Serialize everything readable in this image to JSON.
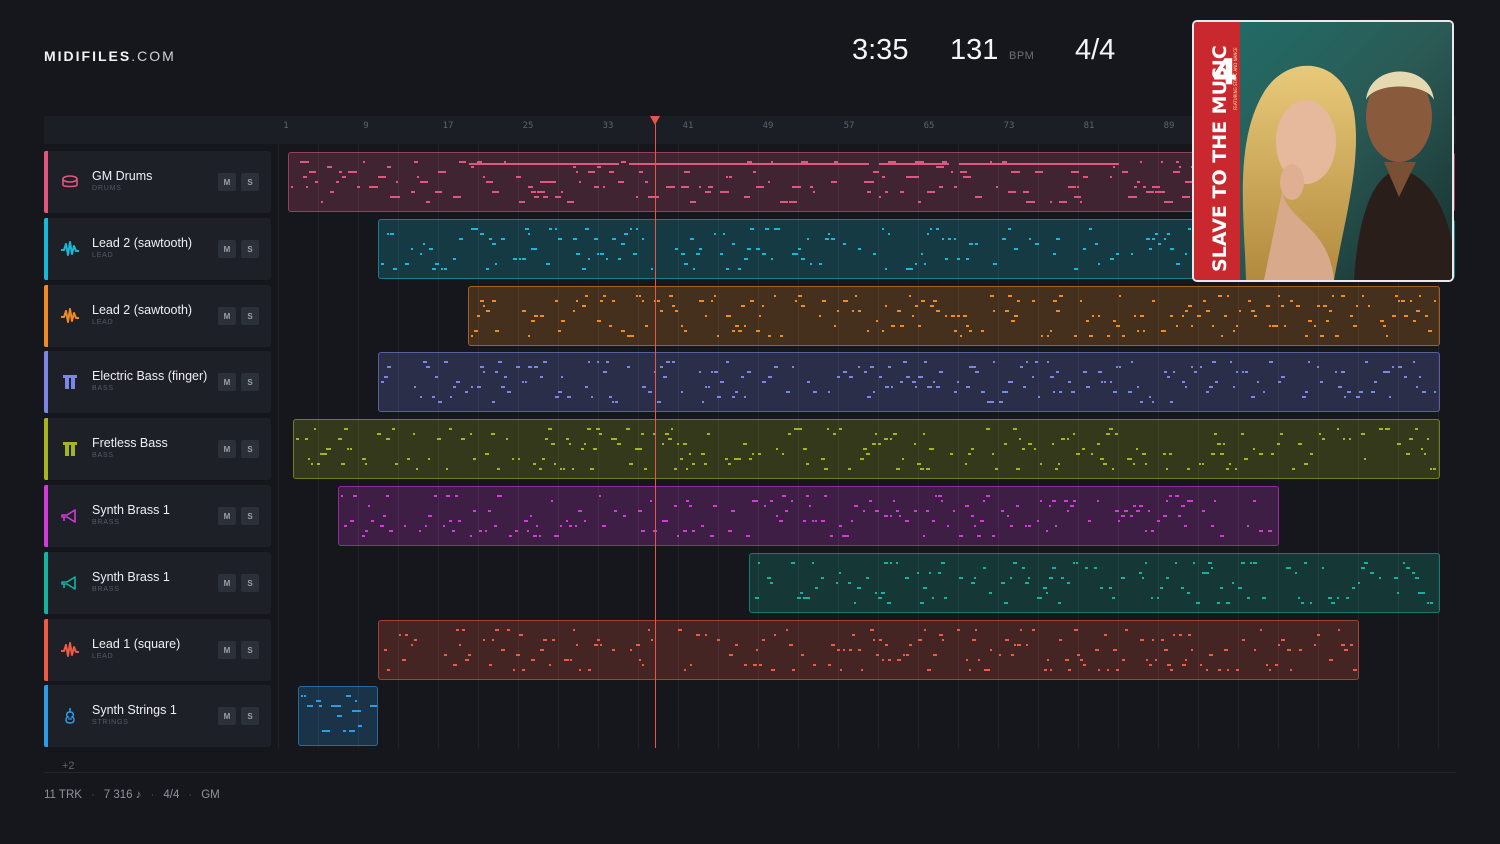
{
  "brand": {
    "name": "MIDIFILES",
    "suffix": ".COM"
  },
  "transport": {
    "time": "3:35",
    "tempo": "131",
    "tempo_unit": "BPM",
    "meter": "4/4"
  },
  "ruler": {
    "labels": [
      "1",
      "9",
      "17",
      "25",
      "33",
      "41",
      "49",
      "57",
      "65",
      "73",
      "81",
      "89"
    ]
  },
  "tracks": [
    {
      "name": "GM Drums",
      "category": "DRUMS",
      "color": "#e0567f",
      "icon": "drum-icon",
      "mute": "M",
      "solo": "S"
    },
    {
      "name": "Lead 2 (sawtooth)",
      "category": "LEAD",
      "color": "#17b9d6",
      "icon": "waveform-icon",
      "mute": "M",
      "solo": "S"
    },
    {
      "name": "Lead 2 (sawtooth)",
      "category": "LEAD",
      "color": "#f08a24",
      "icon": "waveform-icon",
      "mute": "M",
      "solo": "S"
    },
    {
      "name": "Electric Bass (finger)",
      "category": "BASS",
      "color": "#7b86e6",
      "icon": "bass-amp-icon",
      "mute": "M",
      "solo": "S"
    },
    {
      "name": "Fretless Bass",
      "category": "BASS",
      "color": "#a6b51e",
      "icon": "bass-amp-icon",
      "mute": "M",
      "solo": "S"
    },
    {
      "name": "Synth Brass 1",
      "category": "BRASS",
      "color": "#d23bd8",
      "icon": "horn-icon",
      "mute": "M",
      "solo": "S"
    },
    {
      "name": "Synth Brass 1",
      "category": "BRASS",
      "color": "#15b39c",
      "icon": "horn-icon",
      "mute": "M",
      "solo": "S"
    },
    {
      "name": "Lead 1 (square)",
      "category": "LEAD",
      "color": "#ef5a45",
      "icon": "waveform-icon",
      "mute": "M",
      "solo": "S"
    },
    {
      "name": "Synth Strings 1",
      "category": "STRINGS",
      "color": "#2c9be8",
      "icon": "violin-icon",
      "mute": "M",
      "solo": "S"
    }
  ],
  "more_tracks": "+2",
  "footer": {
    "tracks": "11 TRK",
    "notes": "7 316 ♪",
    "meter": "4/4",
    "standard": "GM"
  },
  "cover": {
    "title": "SLAVE TO THE MUSIC",
    "number": "4",
    "credit": "FEATURING STAY-C AND NANCE"
  }
}
